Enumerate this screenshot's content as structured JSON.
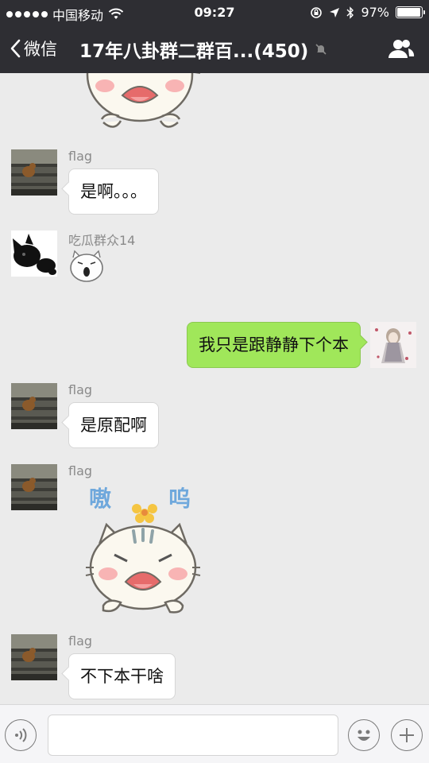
{
  "status_bar": {
    "carrier": "中国移动",
    "time": "09:27",
    "battery": "97%",
    "battery_level": 0.97,
    "signal_dots": 5
  },
  "nav": {
    "back_label": "微信",
    "title": "17年八卦群二群百...(450)",
    "muted": true
  },
  "messages": [
    {
      "type": "sticker",
      "direction": "in",
      "sticker": "angry-cat-sticker-partial"
    },
    {
      "type": "text",
      "direction": "in",
      "sender": "flag",
      "text": "是啊。。。",
      "avatar": "stairs-photo-avatar"
    },
    {
      "type": "sticker",
      "direction": "in",
      "sender": "吃瓜群众14",
      "sticker": "small-cat-face-sticker",
      "avatar": "black-cat-avatar"
    },
    {
      "type": "text",
      "direction": "out",
      "text": "我只是跟静静下个本",
      "avatar": "anime-girl-avatar"
    },
    {
      "type": "text",
      "direction": "in",
      "sender": "flag",
      "text": "是原配啊",
      "avatar": "stairs-photo-avatar"
    },
    {
      "type": "sticker",
      "direction": "in",
      "sender": "flag",
      "sticker": "crying-cat-sticker",
      "sticker_text": [
        "嗷",
        "呜"
      ],
      "avatar": "stairs-photo-avatar"
    },
    {
      "type": "text",
      "direction": "in",
      "sender": "flag",
      "text": "不下本干啥",
      "avatar": "stairs-photo-avatar"
    }
  ],
  "input_bar": {
    "voice_icon": "voice-wave-icon",
    "emoji_icon": "smiley-face-icon",
    "more_icon": "plus-icon",
    "value": ""
  },
  "colors": {
    "bar_bg": "#2e2e33",
    "chat_bg": "#ebebeb",
    "out_bubble": "#a0e75a",
    "in_bubble": "#ffffff"
  }
}
